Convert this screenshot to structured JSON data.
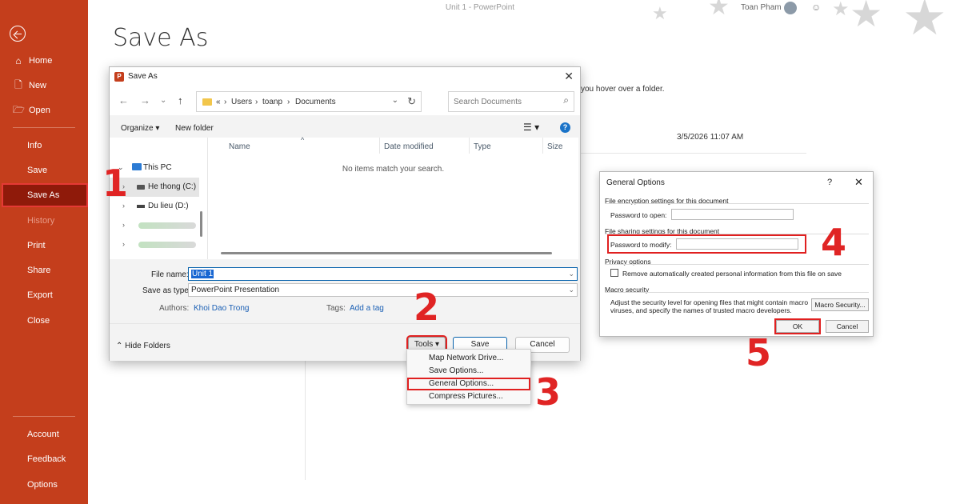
{
  "window": {
    "title": "Unit 1  -  PowerPoint",
    "user": "Toan Pham"
  },
  "page_title": "Save As",
  "sidebar": {
    "items": [
      {
        "label": "Home",
        "icon": "home-icon"
      },
      {
        "label": "New",
        "icon": "new-file-icon"
      },
      {
        "label": "Open",
        "icon": "folder-open-icon"
      },
      {
        "label": "Info"
      },
      {
        "label": "Save"
      },
      {
        "label": "Save As",
        "selected": true
      },
      {
        "label": "History",
        "disabled": true
      },
      {
        "label": "Print"
      },
      {
        "label": "Share"
      },
      {
        "label": "Export"
      },
      {
        "label": "Close"
      }
    ],
    "bottom_items": [
      {
        "label": "Account"
      },
      {
        "label": "Feedback"
      },
      {
        "label": "Options"
      }
    ]
  },
  "background": {
    "hover_tip": "you hover over a folder.",
    "date": "3/5/2026 11:07 AM"
  },
  "save_dialog": {
    "title": "Save As",
    "breadcrumbs": [
      "«",
      "Users",
      "toanp",
      "Documents"
    ],
    "search_placeholder": "Search Documents",
    "organize_label": "Organize",
    "new_folder_label": "New folder",
    "tree": [
      {
        "label": "This PC"
      },
      {
        "label": "He thong (C:)"
      },
      {
        "label": "Du lieu (D:)"
      }
    ],
    "columns": [
      "Name",
      "Date modified",
      "Type",
      "Size"
    ],
    "empty_message": "No items match your search.",
    "file_name_label": "File name:",
    "file_name_value": "Unit 1",
    "save_as_type_label": "Save as type:",
    "save_as_type_value": "PowerPoint Presentation",
    "authors_label": "Authors:",
    "authors_value": "Khoi Dao Trong",
    "tags_label": "Tags:",
    "tags_value": "Add a tag",
    "hide_folders_label": "Hide Folders",
    "tools_label": "Tools",
    "save_label": "Save",
    "cancel_label": "Cancel"
  },
  "tools_menu": {
    "items": [
      "Map Network Drive...",
      "Save Options...",
      "General Options...",
      "Compress Pictures..."
    ]
  },
  "general_options": {
    "title": "General Options",
    "help": "?",
    "encryption_section": "File encryption settings for this document",
    "password_open_label": "Password to open:",
    "sharing_section": "File sharing settings for this document",
    "password_modify_label": "Password to modify:",
    "privacy_section": "Privacy options",
    "remove_info_label": "Remove automatically created personal information from this file on save",
    "macro_section": "Macro security",
    "macro_text": "Adjust the security level for opening files that might contain macro viruses, and specify the names of trusted macro developers.",
    "macro_button": "Macro Security...",
    "ok_label": "OK",
    "cancel_label": "Cancel"
  },
  "steps": [
    "1",
    "2",
    "3",
    "4",
    "5"
  ],
  "colors": {
    "accent": "#c43e1c",
    "selected": "#8f1a0a",
    "highlight": "#e02020",
    "link": "#1a5fb4"
  }
}
